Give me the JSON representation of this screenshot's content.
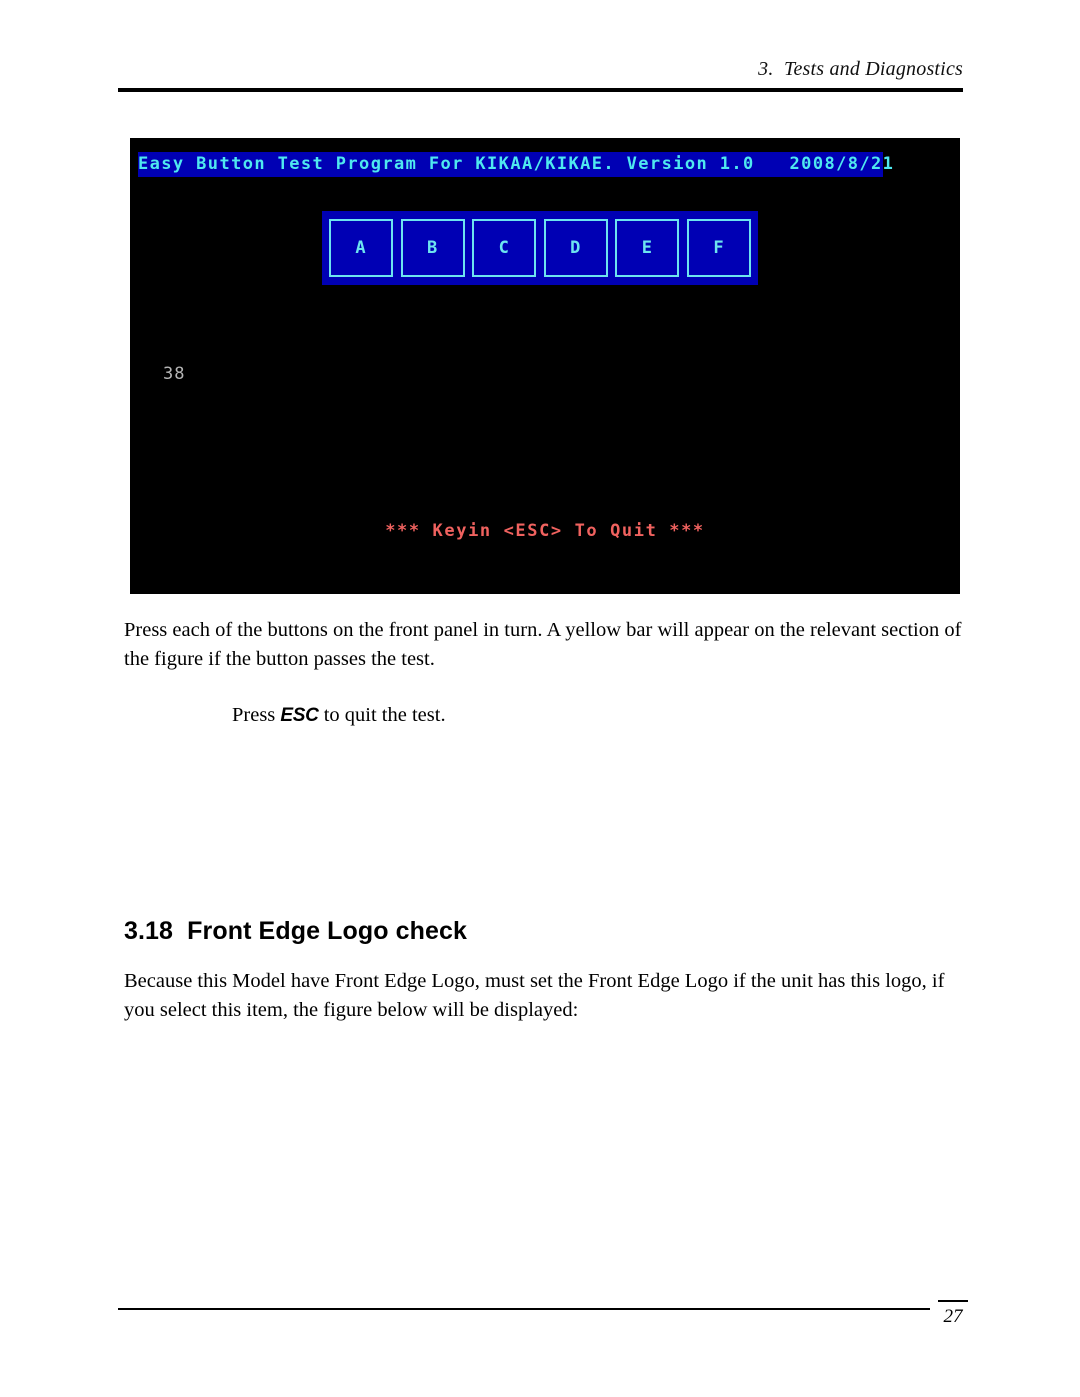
{
  "page": {
    "header_title": "3.  Tests and Diagnostics",
    "page_number": "27"
  },
  "terminal": {
    "title_bar": "Easy Button Test Program For KIKAA/KIKAE. Version 1.0   2008/8/21",
    "index_label": "38",
    "quit_message": "*** Keyin <ESC> To Quit ***",
    "buttons": [
      {
        "label": "A"
      },
      {
        "label": "B"
      },
      {
        "label": "C"
      },
      {
        "label": "D"
      },
      {
        "label": "E"
      },
      {
        "label": "F"
      }
    ],
    "colors": {
      "background": "#000000",
      "title_bar_bg": "#0000b4",
      "title_bar_text": "#4fe8ef",
      "button_border": "#6de4ef",
      "button_fill": "#0000b4",
      "index_text": "#b6b6b6",
      "quit_text": "#f0625f"
    }
  },
  "content": {
    "paragraph_1": "Press each of the buttons on the front panel in turn. A yellow bar will appear on the relevant section of the figure if the button passes the test.",
    "indented_prefix": "Press ",
    "indented_key": "ESC",
    "indented_suffix": " to quit the test."
  },
  "section": {
    "heading": "3.18  Front Edge Logo check",
    "paragraph": "Because this Model have Front Edge Logo, must set the Front Edge Logo if the unit has this logo, if you select this item, the figure below will be displayed:"
  }
}
